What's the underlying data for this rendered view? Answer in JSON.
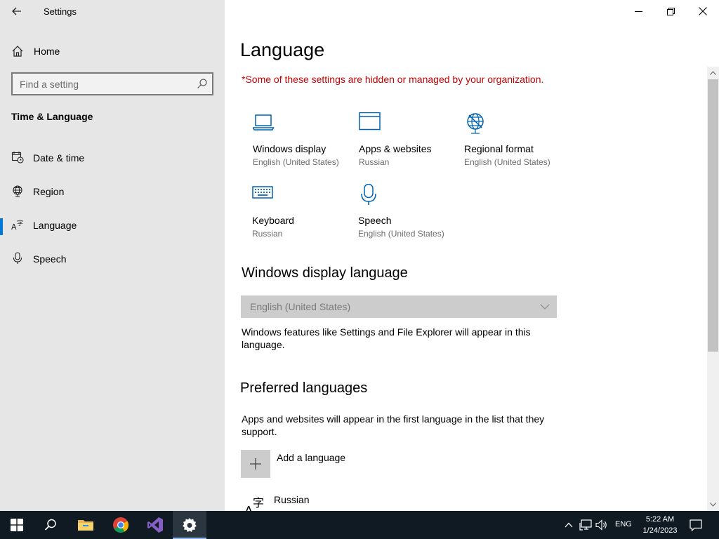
{
  "window": {
    "title": "Settings"
  },
  "sidebar": {
    "home_label": "Home",
    "search_placeholder": "Find a setting",
    "section_title": "Time & Language",
    "items": [
      {
        "label": "Date & time",
        "icon": "calendar-clock-icon"
      },
      {
        "label": "Region",
        "icon": "globe-icon"
      },
      {
        "label": "Language",
        "icon": "language-icon",
        "active": true
      },
      {
        "label": "Speech",
        "icon": "microphone-icon"
      }
    ]
  },
  "main": {
    "title": "Language",
    "org_warning": "*Some of these settings are hidden or managed by your organization.",
    "tiles": [
      {
        "name": "Windows display",
        "value": "English (United States)",
        "icon": "laptop-icon"
      },
      {
        "name": "Apps & websites",
        "value": "Russian",
        "icon": "browser-window-icon"
      },
      {
        "name": "Regional format",
        "value": "English (United States)",
        "icon": "globe-icon"
      },
      {
        "name": "Keyboard",
        "value": "Russian",
        "icon": "keyboard-icon"
      },
      {
        "name": "Speech",
        "value": "English (United States)",
        "icon": "microphone-icon"
      }
    ],
    "display_language": {
      "heading": "Windows display language",
      "selected": "English (United States)",
      "description": "Windows features like Settings and File Explorer will appear in this language."
    },
    "preferred": {
      "heading": "Preferred languages",
      "description": "Apps and websites will appear in the first language in the list that they support.",
      "add_label": "Add a language",
      "languages": [
        "Russian"
      ]
    }
  },
  "taskbar": {
    "apps": [
      "start-icon",
      "search-icon",
      "file-explorer-icon",
      "chrome-icon",
      "visual-studio-icon",
      "settings-icon"
    ],
    "input_language": "ENG",
    "time": "5:22 AM",
    "date": "1/24/2023"
  },
  "colors": {
    "accent": "#0078d7",
    "warning": "#c40000",
    "sidebar_bg": "#e6e6e6",
    "taskbar_bg": "#101a22"
  }
}
